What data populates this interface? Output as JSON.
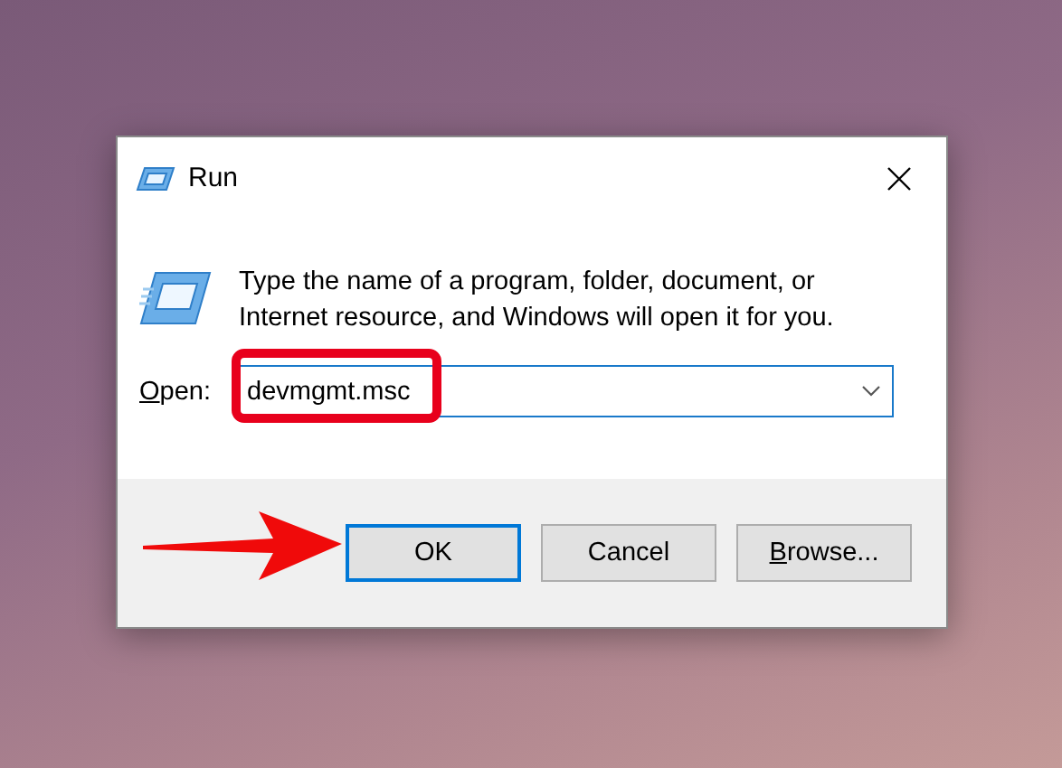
{
  "window": {
    "title": "Run"
  },
  "message": "Type the name of a program, folder, document, or Internet resource, and Windows will open it for you.",
  "open": {
    "label": "Open:",
    "underline_first": true,
    "value": "devmgmt.msc",
    "highlighted": true
  },
  "buttons": [
    {
      "label": "OK",
      "focused": true,
      "underline_first": false
    },
    {
      "label": "Cancel",
      "focused": false,
      "underline_first": false
    },
    {
      "label": "Browse...",
      "focused": false,
      "underline_first": true
    }
  ],
  "annotation": {
    "arrow": true
  }
}
